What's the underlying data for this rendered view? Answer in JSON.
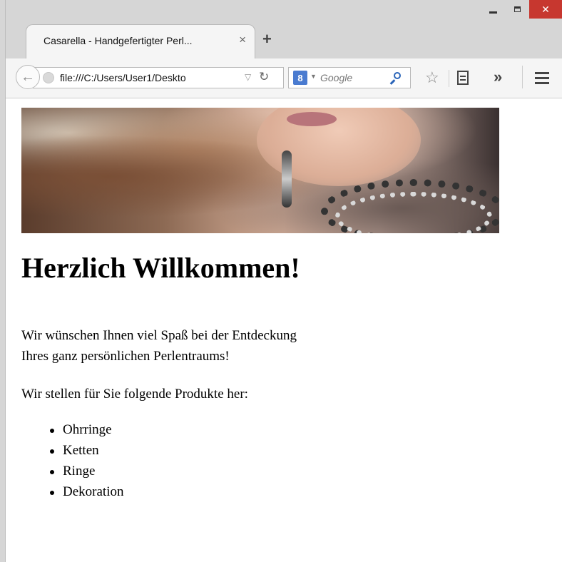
{
  "browser": {
    "tab_title": "Casarella - Handgefertigter Perl...",
    "tab_close": "×",
    "new_tab": "+",
    "address": "file:///C:/Users/User1/Deskto",
    "search_engine_letter": "8",
    "search_placeholder": "Google",
    "window_buttons": {
      "close": "✕"
    }
  },
  "page": {
    "heading": "Herzlich Willkommen!",
    "intro_line1": "Wir wünschen Ihnen viel Spaß bei der Entdeckung",
    "intro_line2": "Ihres ganz persönlichen Perlentraums!",
    "products_intro": "Wir stellen für Sie folgende Produkte her:",
    "products": [
      "Ohrringe",
      "Ketten",
      "Ringe",
      "Dekoration"
    ]
  }
}
